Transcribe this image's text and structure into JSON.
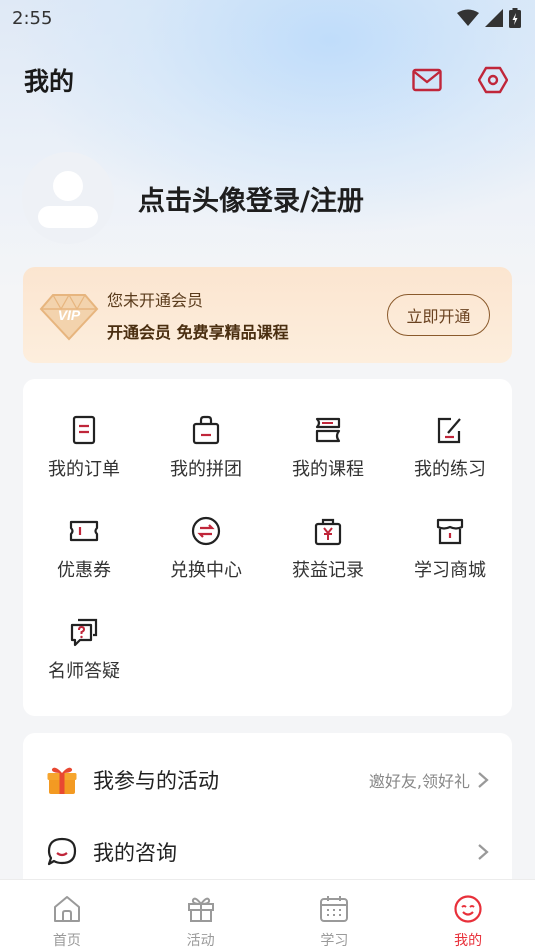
{
  "status_bar": {
    "time": "2:55"
  },
  "header": {
    "title": "我的"
  },
  "colors": {
    "accent": "#e8303a",
    "icon": "#c0263a",
    "vip_text": "#4a2e10"
  },
  "profile": {
    "login_text": "点击头像登录/注册"
  },
  "vip": {
    "badge_text": "VIP",
    "status": "您未开通会员",
    "promo": "开通会员 免费享精品课程",
    "button": "立即开通"
  },
  "grid": {
    "items": [
      {
        "label": "我的订单",
        "icon": "order-icon"
      },
      {
        "label": "我的拼团",
        "icon": "group-buy-icon"
      },
      {
        "label": "我的课程",
        "icon": "course-icon"
      },
      {
        "label": "我的练习",
        "icon": "practice-icon"
      },
      {
        "label": "优惠券",
        "icon": "coupon-icon"
      },
      {
        "label": "兑换中心",
        "icon": "exchange-icon"
      },
      {
        "label": "获益记录",
        "icon": "earnings-icon"
      },
      {
        "label": "学习商城",
        "icon": "store-icon"
      },
      {
        "label": "名师答疑",
        "icon": "qa-icon"
      }
    ]
  },
  "list": {
    "activities": {
      "label": "我参与的活动",
      "hint": "邀好友,领好礼"
    },
    "consult": {
      "label": "我的咨询"
    }
  },
  "tabbar": {
    "tabs": [
      {
        "label": "首页",
        "icon": "home-icon"
      },
      {
        "label": "活动",
        "icon": "gift-icon"
      },
      {
        "label": "学习",
        "icon": "calendar-icon"
      },
      {
        "label": "我的",
        "icon": "smile-icon",
        "active": true
      }
    ]
  }
}
